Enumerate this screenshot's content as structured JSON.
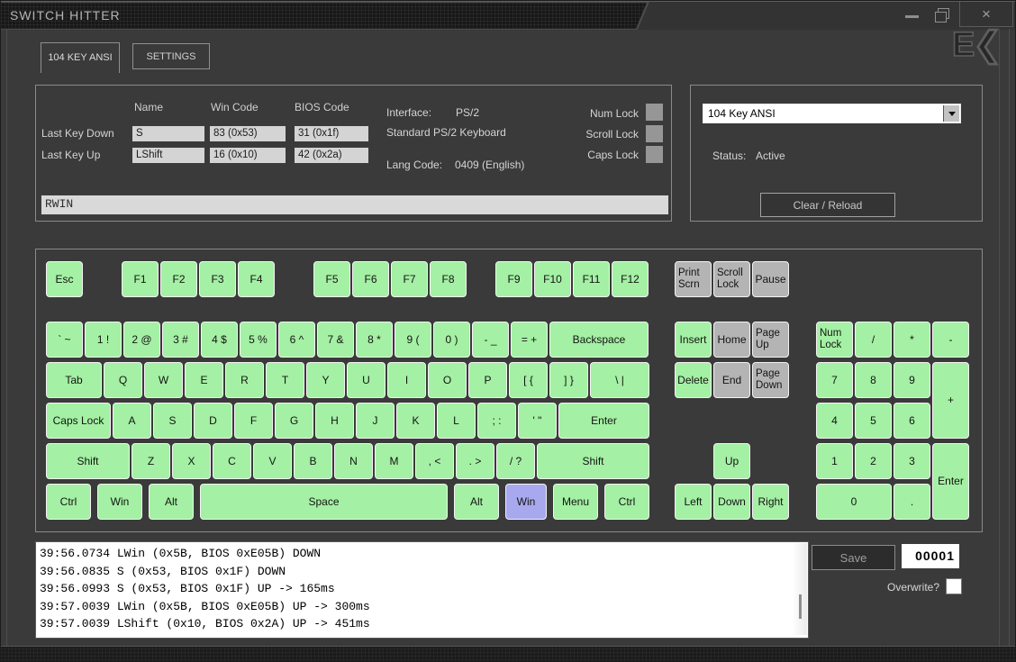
{
  "window": {
    "title": "SWITCH HITTER",
    "logo_text": "E❮",
    "controls": {
      "minimize": "–",
      "maximize": "❐",
      "close": "×"
    }
  },
  "tabs": [
    {
      "label": "104 KEY ANSI",
      "active": true
    },
    {
      "label": "SETTINGS",
      "active": false
    }
  ],
  "info": {
    "columns": [
      "Name",
      "Win Code",
      "BIOS Code"
    ],
    "rows": [
      {
        "label": "Last Key Down",
        "name": "S",
        "win_code": "83 (0x53)",
        "bios_code": "31 (0x1f)"
      },
      {
        "label": "Last Key Up",
        "name": "LShift",
        "win_code": "16 (0x10)",
        "bios_code": "42 (0x2a)"
      }
    ],
    "interface_label": "Interface:",
    "interface_value": "PS/2",
    "device": "Standard PS/2 Keyboard",
    "lang_label": "Lang Code:",
    "lang_value": "0409 (English)",
    "locks": [
      {
        "label": "Num Lock",
        "on": false
      },
      {
        "label": "Scroll Lock",
        "on": false
      },
      {
        "label": "Caps Lock",
        "on": false
      }
    ],
    "key_buffer": "RWIN"
  },
  "layout_panel": {
    "selected_layout": "104 Key ANSI",
    "status_label": "Status:",
    "status_value": "Active",
    "clear_button": "Clear / Reload"
  },
  "keyboard": {
    "main_rows": [
      [
        {
          "l": "Esc",
          "s": "t"
        },
        {
          "l": "F1",
          "s": "t"
        },
        {
          "l": "F2",
          "s": "t"
        },
        {
          "l": "F3",
          "s": "t"
        },
        {
          "l": "F4",
          "s": "t"
        },
        {
          "l": "F5",
          "s": "t"
        },
        {
          "l": "F6",
          "s": "t"
        },
        {
          "l": "F7",
          "s": "t"
        },
        {
          "l": "F8",
          "s": "t"
        },
        {
          "l": "F9",
          "s": "t"
        },
        {
          "l": "F10",
          "s": "t"
        },
        {
          "l": "F11",
          "s": "t"
        },
        {
          "l": "F12",
          "s": "t"
        }
      ],
      [
        {
          "l": "` ~",
          "s": "t"
        },
        {
          "l": "1 !",
          "s": "t"
        },
        {
          "l": "2 @",
          "s": "t"
        },
        {
          "l": "3 #",
          "s": "t"
        },
        {
          "l": "4 $",
          "s": "t"
        },
        {
          "l": "5 %",
          "s": "t"
        },
        {
          "l": "6 ^",
          "s": "t"
        },
        {
          "l": "7 &",
          "s": "t"
        },
        {
          "l": "8 *",
          "s": "t"
        },
        {
          "l": "9 (",
          "s": "t"
        },
        {
          "l": "0 )",
          "s": "t"
        },
        {
          "l": "- _",
          "s": "t"
        },
        {
          "l": "= +",
          "s": "t"
        },
        {
          "l": "Backspace",
          "s": "t"
        }
      ],
      [
        {
          "l": "Tab",
          "s": "t"
        },
        {
          "l": "Q",
          "s": "t"
        },
        {
          "l": "W",
          "s": "t"
        },
        {
          "l": "E",
          "s": "t"
        },
        {
          "l": "R",
          "s": "t"
        },
        {
          "l": "T",
          "s": "t"
        },
        {
          "l": "Y",
          "s": "t"
        },
        {
          "l": "U",
          "s": "t"
        },
        {
          "l": "I",
          "s": "t"
        },
        {
          "l": "O",
          "s": "t"
        },
        {
          "l": "P",
          "s": "t"
        },
        {
          "l": "[ {",
          "s": "t"
        },
        {
          "l": "] }",
          "s": "t"
        },
        {
          "l": "\\ |",
          "s": "t"
        }
      ],
      [
        {
          "l": "Caps Lock",
          "s": "t"
        },
        {
          "l": "A",
          "s": "t"
        },
        {
          "l": "S",
          "s": "t"
        },
        {
          "l": "D",
          "s": "t"
        },
        {
          "l": "F",
          "s": "t"
        },
        {
          "l": "G",
          "s": "t"
        },
        {
          "l": "H",
          "s": "t"
        },
        {
          "l": "J",
          "s": "t"
        },
        {
          "l": "K",
          "s": "t"
        },
        {
          "l": "L",
          "s": "t"
        },
        {
          "l": "; :",
          "s": "t"
        },
        {
          "l": "' \"",
          "s": "t"
        },
        {
          "l": "Enter",
          "s": "t"
        }
      ],
      [
        {
          "l": "Shift",
          "s": "t"
        },
        {
          "l": "Z",
          "s": "t"
        },
        {
          "l": "X",
          "s": "t"
        },
        {
          "l": "C",
          "s": "t"
        },
        {
          "l": "V",
          "s": "t"
        },
        {
          "l": "B",
          "s": "t"
        },
        {
          "l": "N",
          "s": "t"
        },
        {
          "l": "M",
          "s": "t"
        },
        {
          "l": ", <",
          "s": "t"
        },
        {
          "l": ". >",
          "s": "t"
        },
        {
          "l": "/ ?",
          "s": "t"
        },
        {
          "l": "Shift",
          "s": "t"
        }
      ],
      [
        {
          "l": "Ctrl",
          "s": "t"
        },
        {
          "l": "Win",
          "s": "t"
        },
        {
          "l": "Alt",
          "s": "t"
        },
        {
          "l": "Space",
          "s": "t"
        },
        {
          "l": "Alt",
          "s": "t"
        },
        {
          "l": "Win",
          "s": "p"
        },
        {
          "l": "Menu",
          "s": "t"
        },
        {
          "l": "Ctrl",
          "s": "t"
        }
      ]
    ],
    "nav_rows": [
      [
        {
          "l": "Print\nScrn",
          "s": "u"
        },
        {
          "l": "Scroll\nLock",
          "s": "u"
        },
        {
          "l": "Pause",
          "s": "u"
        }
      ],
      [
        {
          "l": "Insert",
          "s": "t"
        },
        {
          "l": "Home",
          "s": "u"
        },
        {
          "l": "Page\nUp",
          "s": "u"
        }
      ],
      [
        {
          "l": "Delete",
          "s": "t"
        },
        {
          "l": "End",
          "s": "u"
        },
        {
          "l": "Page\nDown",
          "s": "u"
        }
      ]
    ],
    "arrow_keys": [
      {
        "l": "Up",
        "s": "t"
      },
      {
        "l": "Left",
        "s": "t"
      },
      {
        "l": "Down",
        "s": "t"
      },
      {
        "l": "Right",
        "s": "t"
      }
    ],
    "numpad_keys": [
      {
        "l": "Num\nLock",
        "s": "t"
      },
      {
        "l": "/",
        "s": "t"
      },
      {
        "l": "*",
        "s": "t"
      },
      {
        "l": "-",
        "s": "t"
      },
      {
        "l": "7",
        "s": "t"
      },
      {
        "l": "8",
        "s": "t"
      },
      {
        "l": "9",
        "s": "t"
      },
      {
        "l": "+",
        "s": "t"
      },
      {
        "l": "4",
        "s": "t"
      },
      {
        "l": "5",
        "s": "t"
      },
      {
        "l": "6",
        "s": "t"
      },
      {
        "l": "1",
        "s": "t"
      },
      {
        "l": "2",
        "s": "t"
      },
      {
        "l": "3",
        "s": "t"
      },
      {
        "l": "Enter",
        "s": "t"
      },
      {
        "l": "0",
        "s": "t"
      },
      {
        "l": ".",
        "s": "t"
      }
    ]
  },
  "log": {
    "lines": [
      "39:56.0734 LWin (0x5B, BIOS 0xE05B) DOWN",
      "39:56.0835 S (0x53, BIOS 0x1F) DOWN",
      "39:56.0993 S (0x53, BIOS 0x1F) UP -> 165ms",
      "39:57.0039 LWin (0x5B, BIOS 0xE05B) UP -> 300ms",
      "39:57.0039 LShift (0x10, BIOS 0x2A) UP -> 451ms"
    ]
  },
  "save_panel": {
    "save_label": "Save",
    "counter": "00001",
    "overwrite_label": "Overwrite?",
    "overwrite_checked": false
  },
  "colors": {
    "key_tested": "#a4f0a4",
    "key_untested": "#b4b4b4",
    "key_pressed": "#a8a8ee",
    "panel_border": "#8a8a8a",
    "background": "#3a3a3a"
  }
}
